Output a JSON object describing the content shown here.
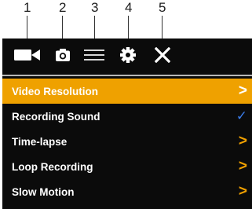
{
  "callouts": [
    "1",
    "2",
    "3",
    "4",
    "5"
  ],
  "tabs": [
    {
      "icon": "video-camera-icon",
      "selected": true
    },
    {
      "icon": "photo-camera-icon",
      "selected": false
    },
    {
      "icon": "menu-icon",
      "selected": false
    },
    {
      "icon": "gear-icon",
      "selected": false
    },
    {
      "icon": "close-icon",
      "selected": false
    }
  ],
  "menu": [
    {
      "label": "Video Resolution",
      "mark": ">",
      "selected": true
    },
    {
      "label": "Recording Sound",
      "mark": "✓",
      "selected": false
    },
    {
      "label": "Time-lapse",
      "mark": ">",
      "selected": false
    },
    {
      "label": "Loop Recording",
      "mark": ">",
      "selected": false
    },
    {
      "label": "Slow Motion",
      "mark": ">",
      "selected": false
    }
  ],
  "colors": {
    "accent": "#efa100",
    "background": "#0b0b0b",
    "text": "#ffffff",
    "check": "#3a7be8"
  }
}
